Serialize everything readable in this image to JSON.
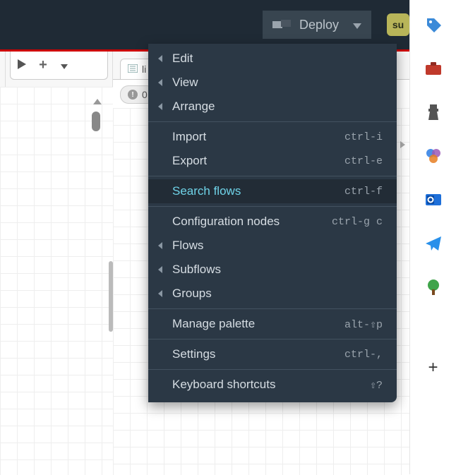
{
  "header": {
    "deploy_label": "Deploy",
    "avatar_initials": "su"
  },
  "toolbar": {
    "list_label": "li"
  },
  "badge": {
    "count": "0"
  },
  "menu": {
    "edit": "Edit",
    "view": "View",
    "arrange": "Arrange",
    "import": "Import",
    "import_sc": "ctrl-i",
    "export": "Export",
    "export_sc": "ctrl-e",
    "search": "Search flows",
    "search_sc": "ctrl-f",
    "config": "Configuration nodes",
    "config_sc": "ctrl-g c",
    "flows": "Flows",
    "subflows": "Subflows",
    "groups": "Groups",
    "palette": "Manage palette",
    "palette_sc": "alt-⇧p",
    "settings": "Settings",
    "settings_sc": "ctrl-,",
    "shortcuts": "Keyboard shortcuts",
    "shortcuts_sc": "⇧?"
  }
}
